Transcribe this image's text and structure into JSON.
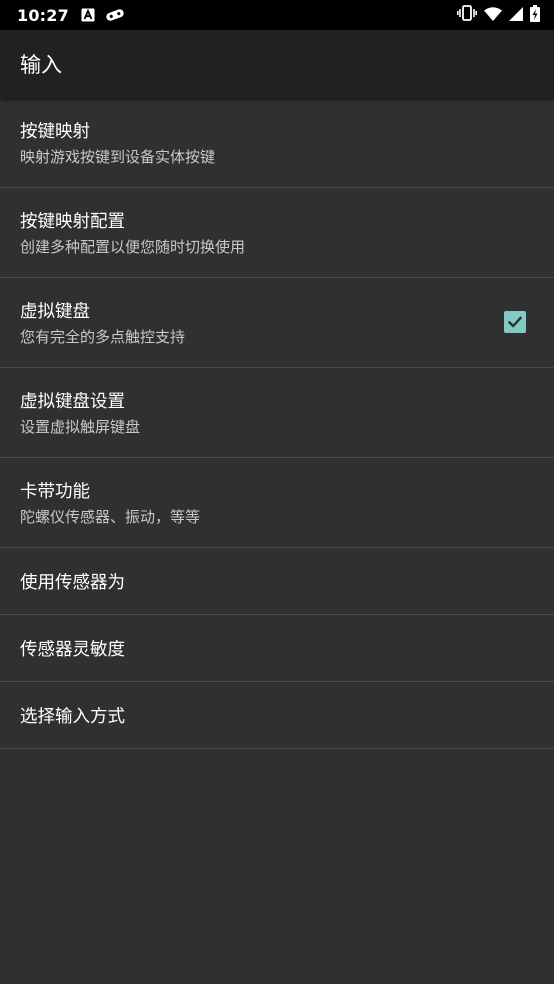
{
  "status_bar": {
    "time": "10:27",
    "left_icons": [
      "a-notification-icon",
      "game-notification-icon"
    ],
    "right_icons": [
      "vibrate-icon",
      "wifi-icon",
      "signal-icon",
      "battery-charging-icon"
    ]
  },
  "app_bar": {
    "title": "输入"
  },
  "settings": {
    "items": [
      {
        "title": "按键映射",
        "subtitle": "映射游戏按键到设备实体按键"
      },
      {
        "title": "按键映射配置",
        "subtitle": "创建多种配置以便您随时切换使用"
      },
      {
        "title": "虚拟键盘",
        "subtitle": "您有完全的多点触控支持",
        "checked": true
      },
      {
        "title": "虚拟键盘设置",
        "subtitle": "设置虚拟触屏键盘"
      },
      {
        "title": "卡带功能",
        "subtitle": "陀螺仪传感器、振动，等等"
      },
      {
        "title": "使用传感器为"
      },
      {
        "title": "传感器灵敏度"
      },
      {
        "title": "选择输入方式"
      }
    ]
  },
  "colors": {
    "background": "#303030",
    "app_bar": "#212121",
    "status_bar": "#000000",
    "accent": "#80cbc4",
    "divider": "#4a4a4a"
  }
}
